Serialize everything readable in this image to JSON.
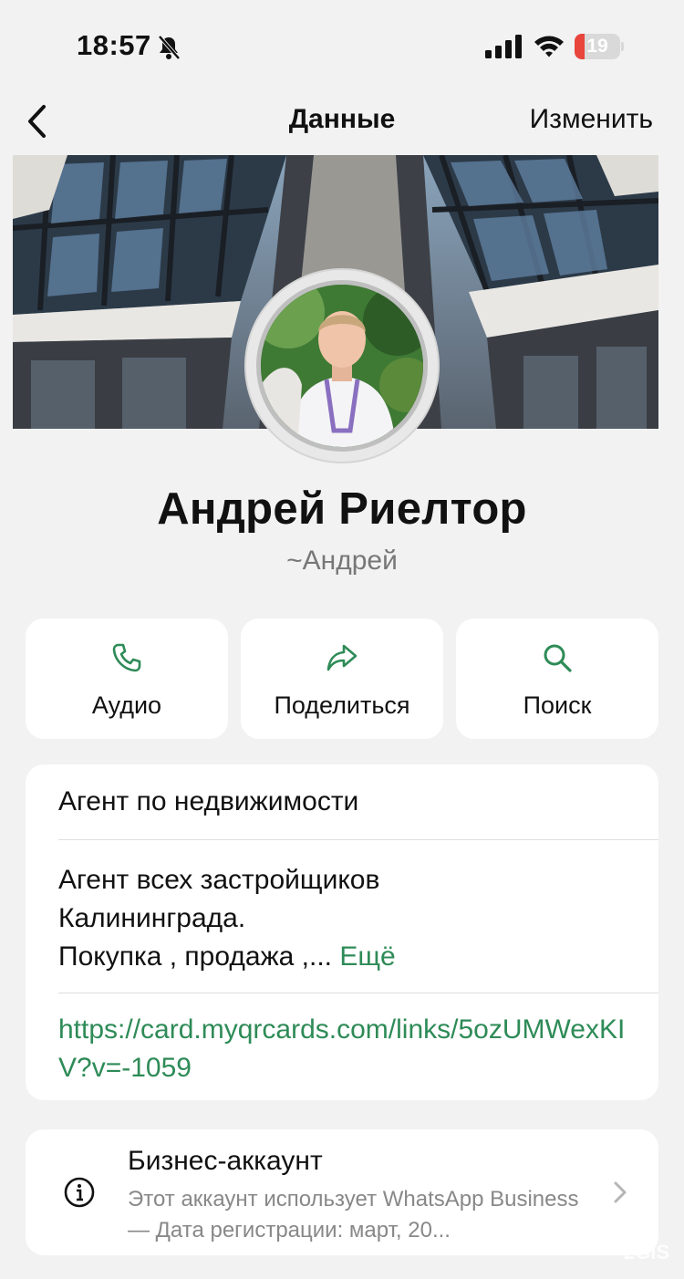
{
  "status_bar": {
    "time": "18:57",
    "battery_level": "19",
    "icons": [
      "bell-slash-icon",
      "signal-icon",
      "wifi-icon",
      "battery-icon"
    ],
    "battery_color": "#e8453c"
  },
  "nav": {
    "title": "Данные",
    "edit_label": "Изменить",
    "back_icon": "chevron-left-icon"
  },
  "profile": {
    "name": "Андрей Риелтор",
    "subname": "~Андрей"
  },
  "actions": [
    {
      "label": "Аудио",
      "icon": "phone-icon"
    },
    {
      "label": "Поделиться",
      "icon": "share-arrow-icon"
    },
    {
      "label": "Поиск",
      "icon": "search-icon"
    }
  ],
  "info": {
    "category": "Агент по недвижимости",
    "about_lines": [
      "Агент всех застройщиков",
      "Калининграда.",
      "Покупка , продажа ,..."
    ],
    "more_label": "Ещё",
    "link": "https://card.myqrcards.com/links/5ozUMWexKIV?v=-1059"
  },
  "business": {
    "title": "Бизнес-аккаунт",
    "description": "Этот аккаунт использует WhatsApp Business — Дата регистрации: март, 20...",
    "icon": "info-circle-icon"
  },
  "watermark": "2GIS",
  "colors": {
    "accent": "#2e8b57",
    "background": "#f2f2f2",
    "card": "#ffffff"
  }
}
